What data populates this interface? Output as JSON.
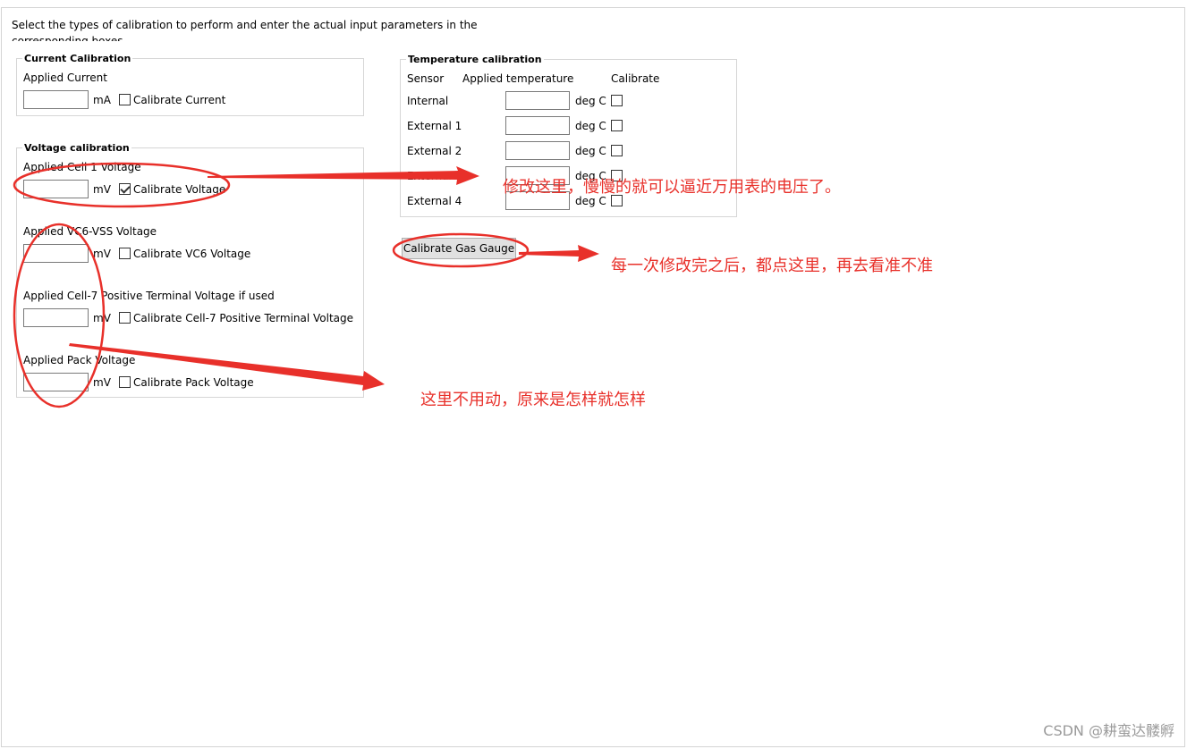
{
  "instructions": "Select the types of calibration to perform and enter the actual input parameters in the corresponding boxes",
  "current_calibration": {
    "title": "Current Calibration",
    "applied_label": "Applied Current",
    "unit": "mA",
    "checkbox_label": "Calibrate Current",
    "value": "",
    "checked": false
  },
  "voltage_calibration": {
    "title": "Voltage calibration",
    "rows": [
      {
        "label": "Applied Cell 1 Voltage",
        "unit": "mV",
        "checkbox_label": "Calibrate Voltage",
        "value": "",
        "checked": true
      },
      {
        "label": "Applied VC6-VSS Voltage",
        "unit": "mV",
        "checkbox_label": "Calibrate VC6 Voltage",
        "value": "",
        "checked": false
      },
      {
        "label": "Applied Cell-7 Positive Terminal Voltage if used",
        "unit": "mV",
        "checkbox_label": "Calibrate Cell-7 Positive Terminal Voltage",
        "value": "",
        "checked": false
      },
      {
        "label": "Applied Pack Voltage",
        "unit": "mV",
        "checkbox_label": "Calibrate Pack Voltage",
        "value": "",
        "checked": false
      }
    ]
  },
  "temperature_calibration": {
    "title": "Temperature calibration",
    "col_sensor": "Sensor",
    "col_applied": "Applied temperature",
    "col_calibrate": "Calibrate",
    "unit": "deg C",
    "rows": [
      {
        "sensor": "Internal",
        "value": "",
        "checked": false
      },
      {
        "sensor": "External 1",
        "value": "",
        "checked": false
      },
      {
        "sensor": "External 2",
        "value": "",
        "checked": false
      },
      {
        "sensor": "External 3",
        "value": "",
        "checked": false
      },
      {
        "sensor": "External 4",
        "value": "",
        "checked": false
      }
    ]
  },
  "calibrate_button": "Calibrate Gas Gauge",
  "annotations": {
    "note_voltage": "修改这里，慢慢的就可以逼近万用表的电压了。",
    "note_button": "每一次修改完之后，都点这里，再去看准不准",
    "note_unused": "这里不用动，原来是怎样就怎样",
    "color": "#e8302a"
  },
  "watermark": "CSDN @耕蛮达髅孵"
}
